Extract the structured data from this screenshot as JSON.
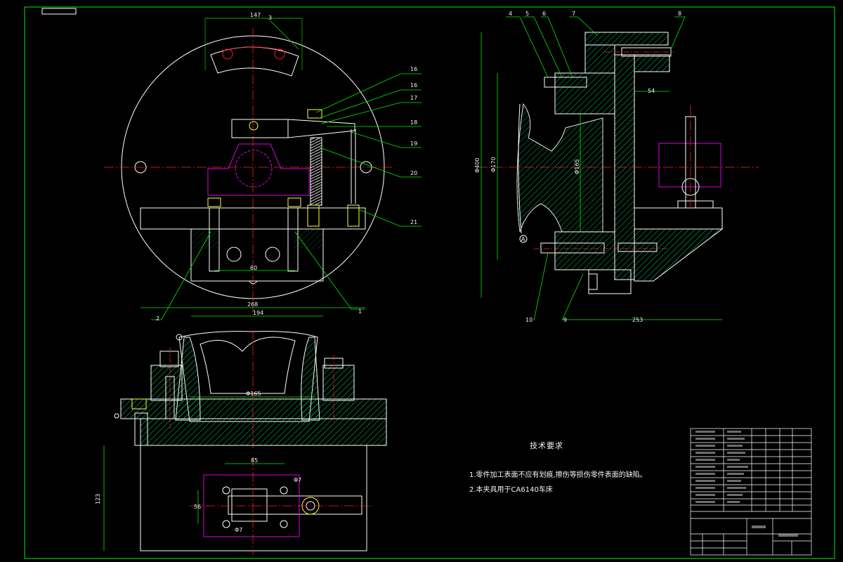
{
  "colors": {
    "background": "#000000",
    "outline": "#ffffff",
    "centerline": "#ff2020",
    "leader": "#00ee00",
    "hidden": "#e000e0",
    "bolt": "#ffff40",
    "hatch": "#00ff80",
    "section": "#40ffff"
  },
  "top_view": {
    "dim_width_top": "147",
    "dim_base": "268",
    "dim_base2": "194",
    "dim_hole": "60",
    "balloons": [
      "16",
      "16",
      "17",
      "18",
      "19",
      "20",
      "21",
      "1",
      "2",
      "3"
    ]
  },
  "side_view": {
    "dim_height": "Φ400",
    "dim_bore": "Φ170",
    "dim_inner": "Φ165",
    "dim_length": "253",
    "dim_step": "54",
    "balloons": [
      "4",
      "5",
      "6",
      "7",
      "8",
      "10",
      "9"
    ],
    "datum": "A"
  },
  "front_view": {
    "dim_width": "Φ165",
    "dim_height": "123",
    "dim_slot": "85",
    "dim_side": "56",
    "dim_hole_top": "Φ7",
    "dim_hole_bottom": "Φ7"
  },
  "notes": {
    "heading": "技术要求",
    "items": [
      "1.零件加工表面不应有划痕,擦伤等损伤零件表面的缺陷。",
      "2.本夹具用于CA6140车床"
    ]
  }
}
